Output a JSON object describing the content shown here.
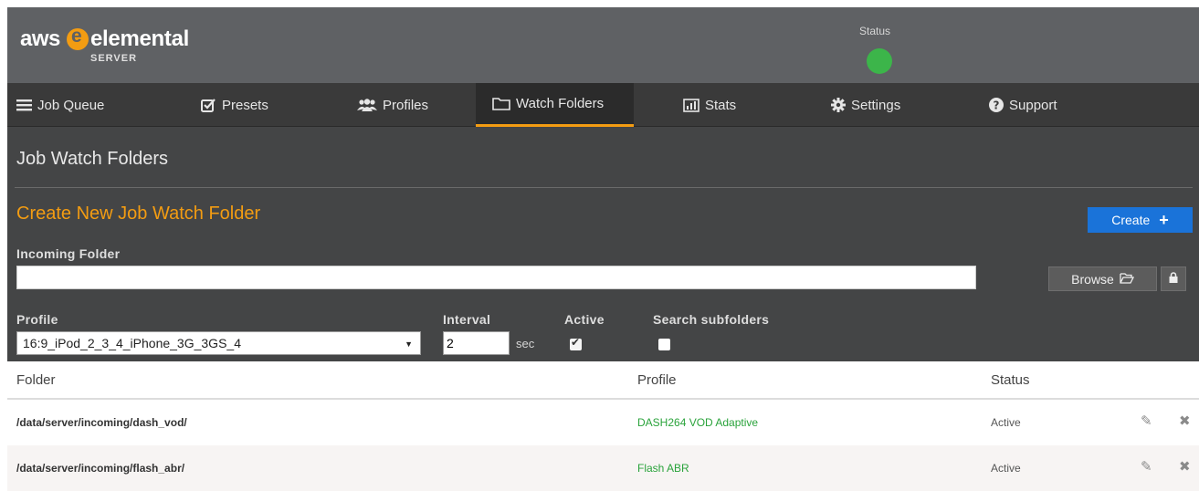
{
  "header": {
    "logo_aws": "aws",
    "logo_elemental": "elemental",
    "logo_server": "SERVER",
    "status_label": "Status",
    "status_color": "#3cb54a"
  },
  "nav": {
    "items": [
      {
        "label": "Job Queue",
        "icon": "hamburger-icon"
      },
      {
        "label": "Presets",
        "icon": "checkbox-icon"
      },
      {
        "label": "Profiles",
        "icon": "users-icon"
      },
      {
        "label": "Watch Folders",
        "icon": "folder-icon",
        "active": true
      },
      {
        "label": "Stats",
        "icon": "bar-chart-icon"
      },
      {
        "label": "Settings",
        "icon": "gear-icon"
      },
      {
        "label": "Support",
        "icon": "question-circle-icon"
      }
    ]
  },
  "main": {
    "page_title": "Job Watch Folders",
    "section_title": "Create New Job Watch Folder",
    "create_label": "Create",
    "incoming_label": "Incoming Folder",
    "incoming_value": "",
    "browse_label": "Browse",
    "profile_label": "Profile",
    "profile_value": "16:9_iPod_2_3_4_iPhone_3G_3GS_4",
    "interval_label": "Interval",
    "interval_value": "2",
    "sec_label": "sec",
    "active_label": "Active",
    "active_checked": true,
    "subfolders_label": "Search subfolders",
    "subfolders_checked": false
  },
  "table": {
    "headers": {
      "folder": "Folder",
      "profile": "Profile",
      "status": "Status"
    },
    "rows": [
      {
        "folder": "/data/server/incoming/dash_vod/",
        "profile": "DASH264 VOD Adaptive",
        "status": "Active"
      },
      {
        "folder": "/data/server/incoming/flash_abr/",
        "profile": "Flash ABR",
        "status": "Active"
      }
    ]
  },
  "colors": {
    "accent": "#f39c12",
    "primary_button": "#1a73d9",
    "profile_link": "#2aa33b"
  }
}
